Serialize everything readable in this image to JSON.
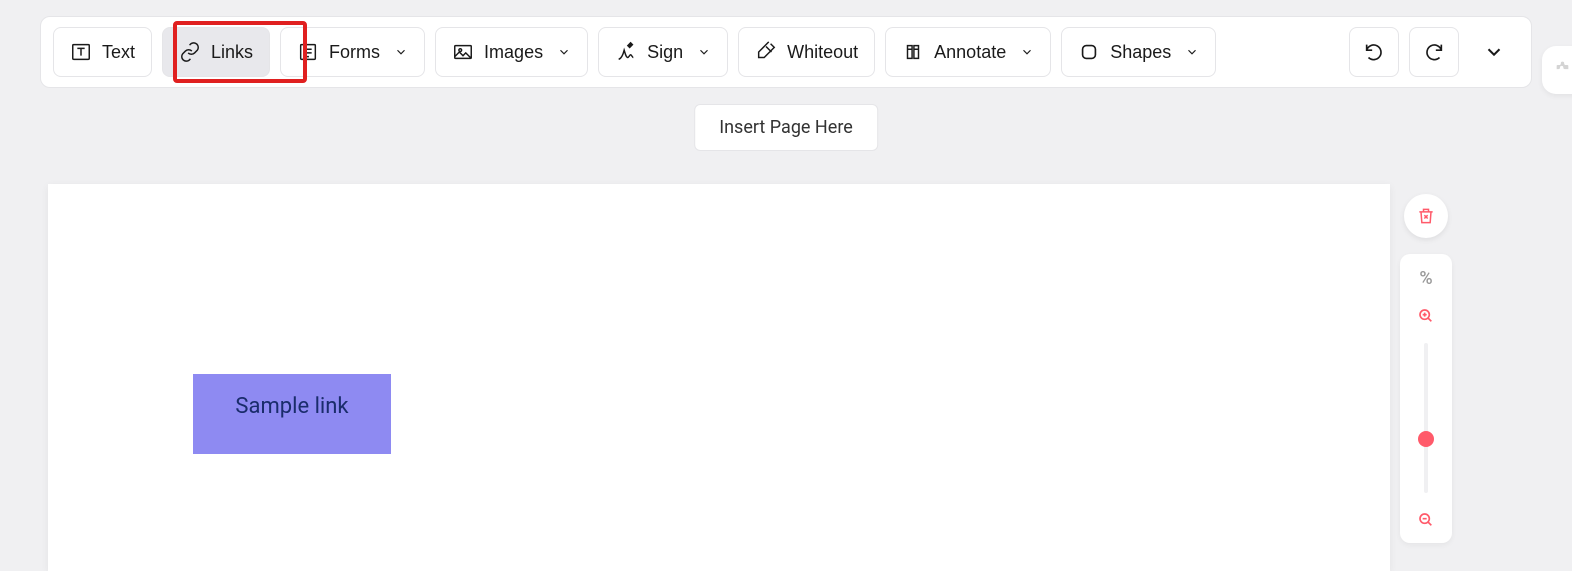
{
  "toolbar": {
    "text_label": "Text",
    "links_label": "Links",
    "forms_label": "Forms",
    "images_label": "Images",
    "sign_label": "Sign",
    "whiteout_label": "Whiteout",
    "annotate_label": "Annotate",
    "shapes_label": "Shapes"
  },
  "insert_page_label": "Insert Page Here",
  "page": {
    "sample_link_text": "Sample link"
  },
  "zoom": {
    "percent_symbol": "%"
  },
  "colors": {
    "highlight": "#e02020",
    "accent": "#ff5a6a",
    "link_bg": "#8e8af2",
    "link_text": "#1a2c6b"
  }
}
